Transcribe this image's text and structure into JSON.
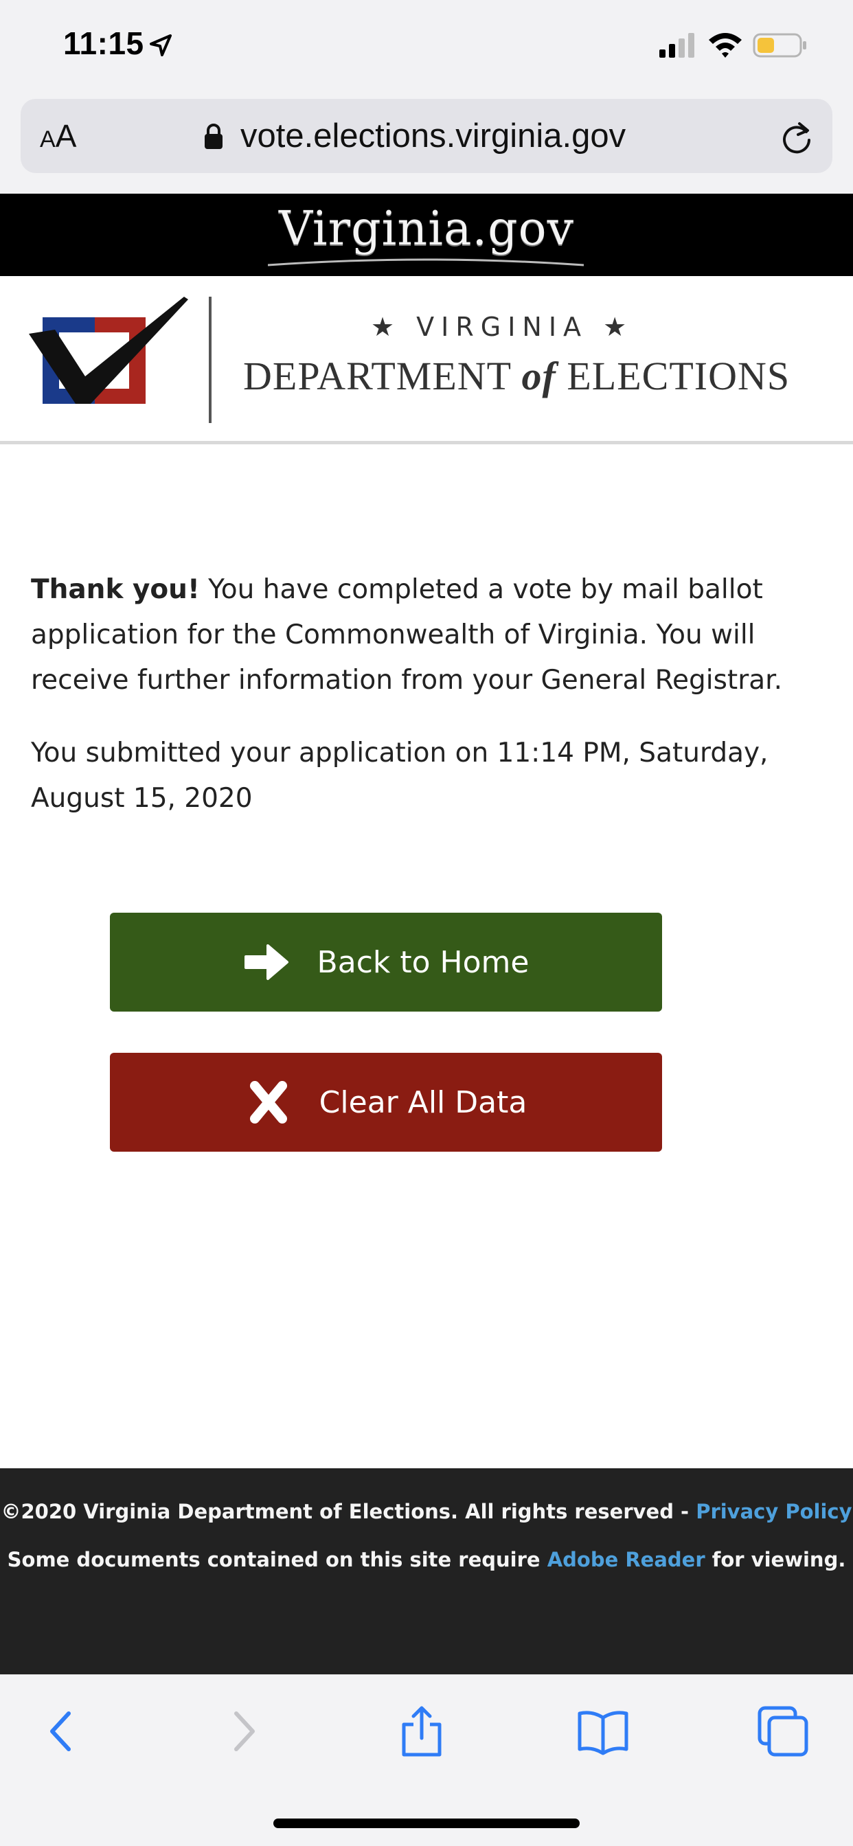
{
  "status_bar": {
    "time": "11:15",
    "icons": [
      "location-arrow-icon",
      "signal-icon",
      "wifi-icon",
      "battery-icon"
    ],
    "battery_color": "#f5c33b"
  },
  "browser": {
    "aa_small": "A",
    "aa_large": "A",
    "url": "vote.elections.virginia.gov",
    "icons": [
      "lock-icon",
      "reload-icon"
    ]
  },
  "va_banner": {
    "logo_text": "Virginia.gov"
  },
  "dept_header": {
    "state": "★ VIRGINIA ★",
    "name_before": "DEPARTMENT ",
    "name_of": "of",
    "name_after": " ELECTIONS",
    "logo_icon": "checkmark-ballot-icon"
  },
  "content": {
    "thanks": "Thank you!",
    "message": " You have completed a vote by mail ballot application for the Commonwealth of Virginia. You will receive further information from your General Registrar.",
    "submitted": "You submitted your application on 11:14 PM, Saturday, August 15, 2020"
  },
  "buttons": {
    "home_label": "Back to Home",
    "home_icon": "arrow-right-icon",
    "home_color": "#355a18",
    "clear_label": "Clear All Data",
    "clear_icon": "x-icon",
    "clear_color": "#8a1c12"
  },
  "footer": {
    "copyright": "©2020 Virginia Department of Elections. All rights reserved - ",
    "privacy_link": "Privacy Policy",
    "docs_before": "Some documents contained on this site require ",
    "adobe_link": "Adobe Reader",
    "docs_after": " for viewing.",
    "link_color": "#4ea0dc"
  },
  "toolbar": {
    "icons": [
      "back-icon",
      "forward-icon",
      "share-icon",
      "bookmarks-icon",
      "tabs-icon"
    ],
    "accent": "#2f7cf6"
  }
}
